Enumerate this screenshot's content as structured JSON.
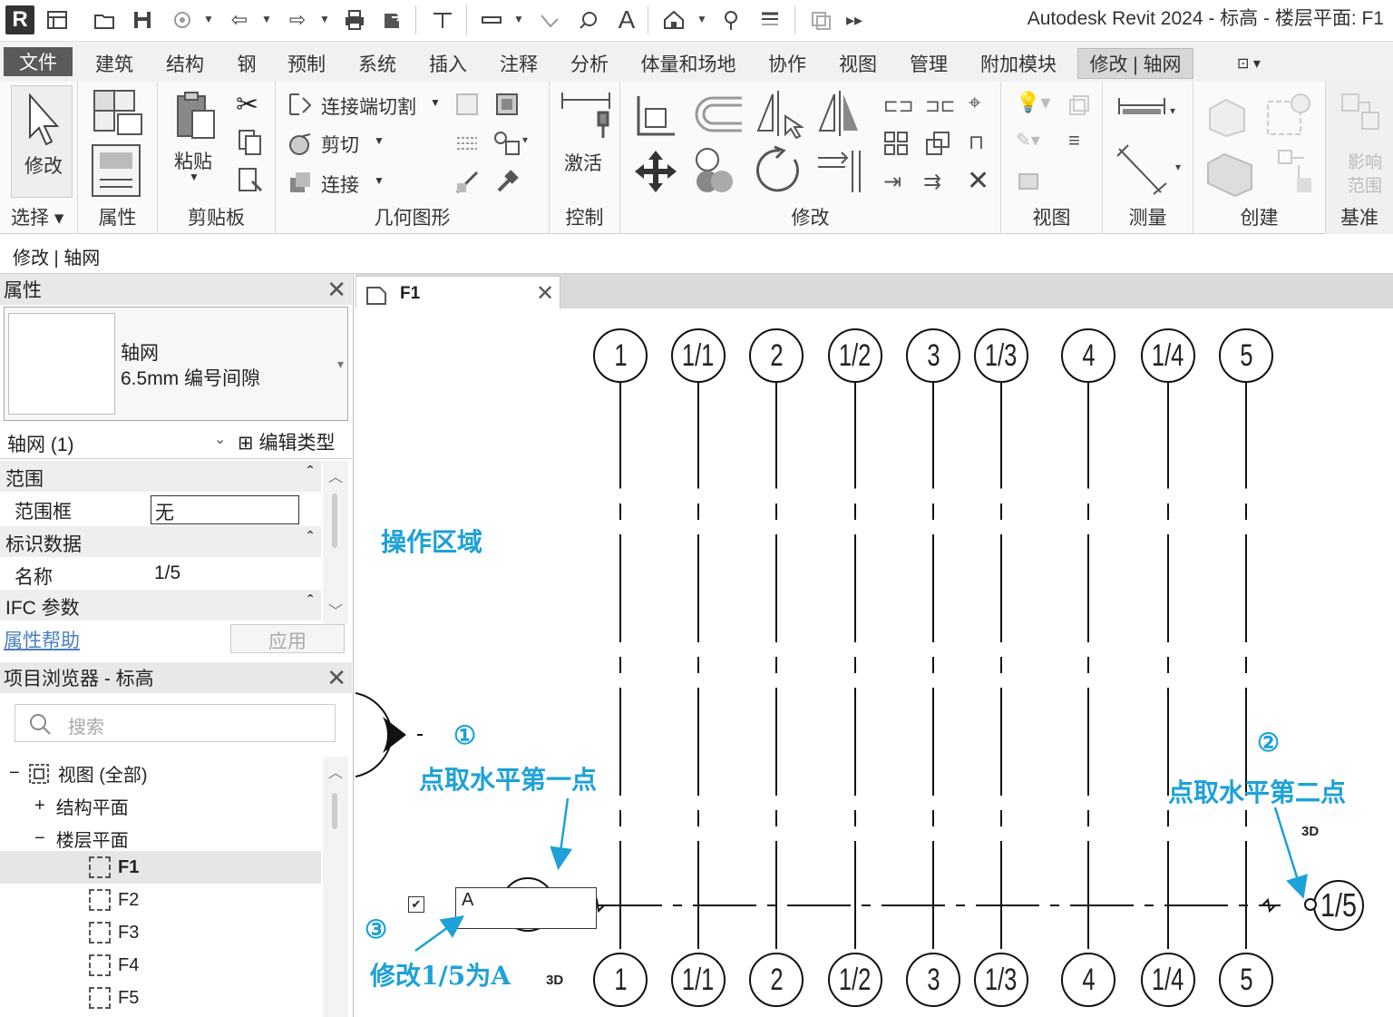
{
  "app": {
    "title": "Autodesk Revit 2024 - 标高 - 楼层平面: F1",
    "logo": "R"
  },
  "menu": {
    "tabs": [
      "文件",
      "建筑",
      "结构",
      "钢",
      "预制",
      "系统",
      "插入",
      "注释",
      "分析",
      "体量和场地",
      "协作",
      "视图",
      "管理",
      "附加模块",
      "修改 | 轴网"
    ],
    "active": "修改 | 轴网"
  },
  "ribbon": {
    "modify_label": "修改",
    "select_label": "选择",
    "properties_label": "属性",
    "paste_label": "粘贴",
    "clipboard_label": "剪贴板",
    "join_cut_label": "连接端切割",
    "cut_label": "剪切",
    "join_label": "连接",
    "geometry_label": "几何图形",
    "activate_label": "激活",
    "control_label": "控制",
    "modify_panel_label": "修改",
    "view_panel_label": "视图",
    "measure_panel_label": "测量",
    "create_panel_label": "创建",
    "datum_panel_label": "基准",
    "scope_box_label_1": "影响",
    "scope_box_label_2": "范围"
  },
  "context_bar": {
    "text": "修改 | 轴网"
  },
  "properties": {
    "title": "属性",
    "type_family": "轴网",
    "type_name": "6.5mm 编号间隙",
    "selector": "轴网 (1)",
    "edit_type": "编辑类型",
    "groups": [
      {
        "name": "范围",
        "rows": [
          {
            "label": "范围框",
            "value": "无"
          }
        ]
      },
      {
        "name": "标识数据",
        "rows": [
          {
            "label": "名称",
            "value": "1/5"
          }
        ]
      },
      {
        "name": "IFC 参数",
        "rows": []
      }
    ],
    "help_link": "属性帮助",
    "apply_button": "应用"
  },
  "browser": {
    "title": "项目浏览器 - 标高",
    "search_placeholder": "搜索",
    "root": "视图 (全部)",
    "structural_plans": "结构平面",
    "floor_plans": "楼层平面",
    "levels": [
      "F1",
      "F2",
      "F3",
      "F4",
      "F5"
    ],
    "selected": "F1"
  },
  "view": {
    "tab_label": "F1",
    "grid_labels": [
      "1",
      "1/1",
      "2",
      "1/2",
      "3",
      "1/3",
      "4",
      "1/4",
      "5"
    ],
    "horizontal_grid_label": "1/5",
    "edit_box_value": "A",
    "tag_3d": "3D"
  },
  "annotations": {
    "work_area": "操作区域",
    "step1_num": "①",
    "step1": "点取水平第一点",
    "step2_num": "②",
    "step2": "点取水平第二点",
    "step3_num": "③",
    "step3": "修改1/5为A"
  },
  "colors": {
    "annotation": "#1da1d8",
    "file_tab": "#5a5a5a",
    "ribbon_bg": "#fafafa"
  }
}
